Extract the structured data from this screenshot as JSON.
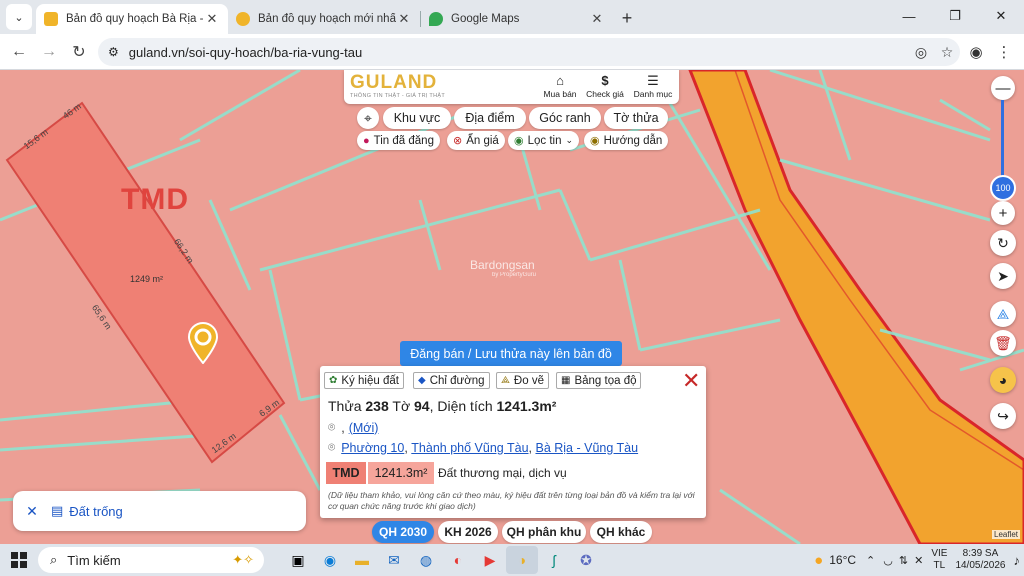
{
  "browser": {
    "tabs": [
      {
        "title": "Bản đồ quy hoạch Bà Rịa - Vũng Tàu",
        "active": true
      },
      {
        "title": "Bản đồ quy hoạch mới nhất Thành phố",
        "active": false
      },
      {
        "title": "Google Maps",
        "active": false
      }
    ],
    "url": "guland.vn/soi-quy-hoach/ba-ria-vung-tau"
  },
  "header": {
    "logo": "GULAND",
    "slogan": "THÔNG TIN THẬT - GIÁ TRỊ THẬT",
    "nav": [
      "Mua bán",
      "Check giá",
      "Danh mục"
    ]
  },
  "filters": {
    "row1": [
      "Khu vực",
      "Địa điểm",
      "Góc ranh",
      "Tờ thửa"
    ],
    "row2": [
      "Tin đã đăng",
      "Ẩn giá",
      "Lọc tin",
      "Hướng dẫn"
    ]
  },
  "map": {
    "zone_label": "TMD",
    "area_label": "1249 m²",
    "dims": [
      "46 m",
      "15,6 m",
      "66,2 m",
      "65,6 m",
      "6,9 m",
      "12,6 m"
    ],
    "watermark": "Bardongsan",
    "watermark_sub": "by PropertyGuru"
  },
  "zoom": {
    "level": "100"
  },
  "post_button": "Đăng bán / Lưu thửa này lên bản đồ",
  "popup": {
    "tabs": [
      "Ký hiệu đất",
      "Chỉ đường",
      "Đo vẽ",
      "Bảng tọa độ"
    ],
    "t_thua": "Thửa",
    "parcel": "238",
    "t_to": "Tờ",
    "sheet": "94",
    "t_dt": ", Diện tích",
    "area": "1241.3m²",
    "address_line1_prefix": ",",
    "address_line1_link": "(Mới)",
    "address_parts": [
      "Phường 10",
      "Thành phố Vũng Tàu",
      "Bà Rịa - Vũng Tàu"
    ],
    "zone_code": "TMD",
    "zone_area": "1241.3m²",
    "zone_desc": "Đất thương mại, dịch vụ",
    "note": "(Dữ liệu tham khảo, vui lòng căn cứ theo màu, ký hiệu đất trên từng loại bản đồ và kiểm tra lại với cơ quan chức năng trước khi giao dịch)"
  },
  "empty_card": {
    "label": "Đất trống"
  },
  "plan_buttons": [
    "QH 2030",
    "KH 2026",
    "QH phân khu",
    "QH khác"
  ],
  "leaflet": "Leaflet",
  "taskbar": {
    "search": "Tìm kiếm",
    "weather": "16°C",
    "lang": "VIE",
    "lang2": "TL",
    "time": "8:39 SA",
    "date": "14/05/2026"
  },
  "colors": {
    "accent": "#2f86e6",
    "zone": "#ec9f95",
    "road": "#f2a32e",
    "line": "#8fe3cf"
  }
}
